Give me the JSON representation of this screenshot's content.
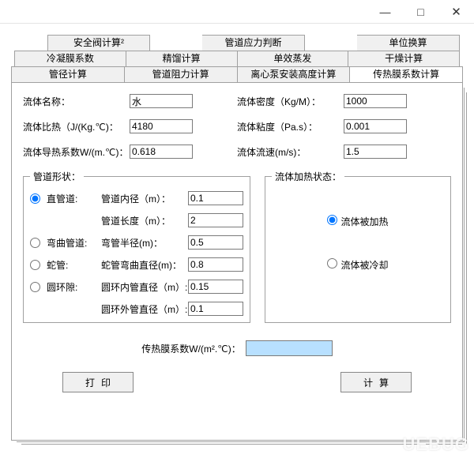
{
  "window": {
    "min": "—",
    "max": "□",
    "close": "✕"
  },
  "tabs": {
    "row1": [
      "安全阀计算²",
      "管道应力判断",
      "单位换算"
    ],
    "row2": [
      "冷凝膜系数",
      "精馏计算",
      "单效蒸发",
      "干燥计算"
    ],
    "row3": [
      "管径计算",
      "管道阻力计算",
      "离心泵安装高度计算",
      "传热膜系数计算"
    ]
  },
  "labels": {
    "fluid_name": "流体名称：",
    "fluid_density": "流体密度（Kg/M）：",
    "fluid_cp": "流体比热（J/(Kg.℃)：",
    "fluid_visc": "流体粘度（Pa.s）：",
    "fluid_k": "流体导热系数W/(m.℃)：",
    "fluid_vel": "流体流速(m/s)：",
    "pipe_shape": "管道形状：",
    "heat_state": "流体加热状态：",
    "straight": "直管道:",
    "inner_d": "管道内径（m）：",
    "pipe_len": "管道长度（m）：",
    "bend": "弯曲管道:",
    "bend_r": "弯管半径(m)：",
    "coil": "蛇管:",
    "coil_d": "蛇管弯曲直径(m)：",
    "annulus": "圆环隙:",
    "ann_in": "圆环内管直径（m）:",
    "ann_out": "圆环外管直径（m）:",
    "heated": "流体被加热",
    "cooled": "流体被冷却",
    "result": "传热膜系数W/(m².℃)：",
    "print": "打印",
    "calc": "计算"
  },
  "values": {
    "fluid_name": "水",
    "fluid_density": "1000",
    "fluid_cp": "4180",
    "fluid_visc": "0.001",
    "fluid_k": "0.618",
    "fluid_vel": "1.5",
    "inner_d": "0.1",
    "pipe_len": "2",
    "bend_r": "0.5",
    "coil_d": "0.8",
    "ann_in": "0.15",
    "ann_out": "0.1",
    "result": ""
  },
  "watermark": "UEBUG"
}
